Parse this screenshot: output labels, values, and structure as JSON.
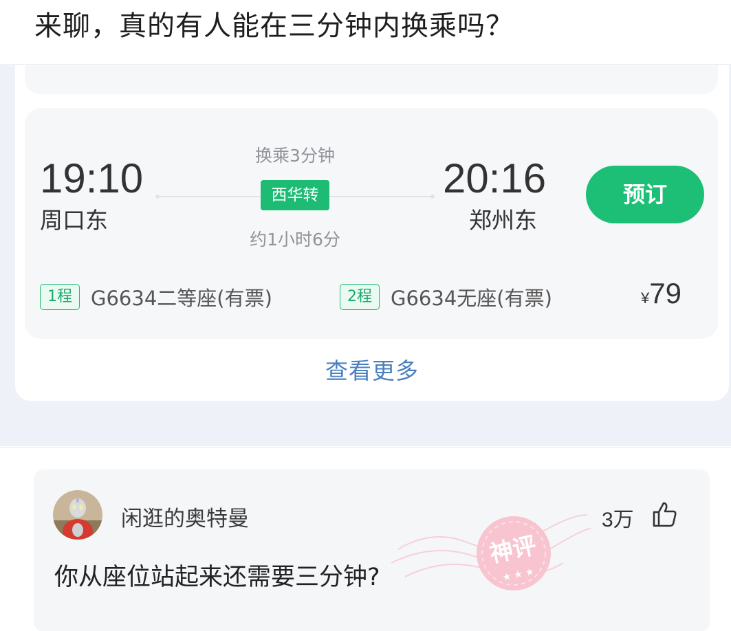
{
  "post": {
    "title": "来聊，真的有人能在三分钟内换乘吗？"
  },
  "ticket": {
    "depart_time": "19:10",
    "depart_station": "周口东",
    "arrive_time": "20:16",
    "arrive_station": "郑州东",
    "transfer_time": "换乘3分钟",
    "transfer_station": "西华转",
    "duration": "约1小时6分",
    "book_label": "预订",
    "legs": [
      {
        "badge": "1程",
        "detail": "G6634二等座(有票)"
      },
      {
        "badge": "2程",
        "detail": "G6634无座(有票)"
      }
    ],
    "price_currency": "¥",
    "price_value": "79"
  },
  "results": {
    "view_more_label": "查看更多"
  },
  "comment": {
    "username": "闲逛的奥特曼",
    "like_count": "3万",
    "text": "你从座位站起来还需要三分钟?",
    "stamp_text": "神评",
    "icons": {
      "like": "thumbs-up-icon",
      "stamp": "god-comment-stamp"
    }
  },
  "colors": {
    "accent_green": "#1dbf76",
    "link_blue": "#4a7fbf",
    "stamp_pink": "#f2b8c4"
  }
}
